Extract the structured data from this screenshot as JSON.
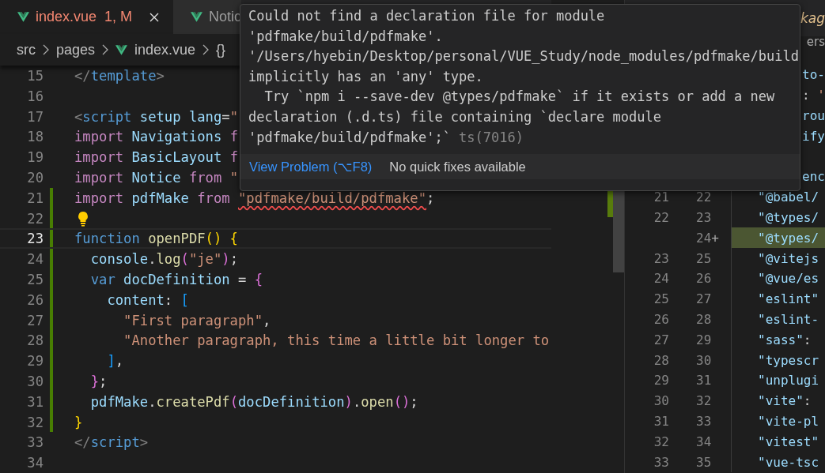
{
  "editor": {
    "tabs": [
      {
        "label": "index.vue",
        "badge": "1, M",
        "selected": true,
        "error": true
      },
      {
        "label": "Notic",
        "selected": false
      }
    ],
    "breadcrumb": [
      "src",
      "pages",
      "index.vue",
      "{}"
    ],
    "lines": [
      {
        "number": "15",
        "modified": false,
        "current": false,
        "tokens": [
          {
            "kind": "tag",
            "text": "</"
          },
          {
            "kind": "tagname",
            "text": "template"
          },
          {
            "kind": "tag",
            "text": ">"
          }
        ]
      },
      {
        "number": "16",
        "modified": false,
        "current": false
      },
      {
        "number": "17",
        "modified": false,
        "current": false,
        "tokens": [
          {
            "kind": "tag",
            "text": "<"
          },
          {
            "kind": "tagname",
            "text": "script "
          },
          {
            "kind": "attr",
            "text": "setup lang"
          },
          {
            "kind": "punct",
            "text": "="
          },
          {
            "kind": "string",
            "text": "\""
          }
        ]
      },
      {
        "number": "18",
        "modified": false,
        "current": false,
        "tokens": [
          {
            "kind": "keyword",
            "text": "import "
          },
          {
            "kind": "var",
            "text": "Navigations "
          },
          {
            "kind": "keyword",
            "text": "f"
          }
        ]
      },
      {
        "number": "19",
        "modified": false,
        "current": false,
        "tokens": [
          {
            "kind": "keyword",
            "text": "import "
          },
          {
            "kind": "var",
            "text": "BasicLayout "
          },
          {
            "kind": "keyword",
            "text": "f"
          }
        ]
      },
      {
        "number": "20",
        "modified": false,
        "current": false,
        "tokens": [
          {
            "kind": "keyword",
            "text": "import "
          },
          {
            "kind": "var",
            "text": "Notice "
          },
          {
            "kind": "keyword",
            "text": "from "
          },
          {
            "kind": "string",
            "text": "\""
          }
        ]
      },
      {
        "number": "21",
        "modified": true,
        "current": false,
        "tokens": [
          {
            "kind": "keyword",
            "text": "import "
          },
          {
            "kind": "var",
            "text": "pdfMake "
          },
          {
            "kind": "keyword",
            "text": "from "
          },
          {
            "kind": "string",
            "text": "\"pdfmake/build/pdfmake\"",
            "squiggle": true
          },
          {
            "kind": "punct",
            "text": ";"
          }
        ]
      },
      {
        "number": "22",
        "modified": true,
        "current": false,
        "lightbulb": true
      },
      {
        "number": "23",
        "modified": true,
        "current": true,
        "tokens": [
          {
            "kind": "storage",
            "text": "function "
          },
          {
            "kind": "fn",
            "text": "openPDF"
          },
          {
            "kind": "brace1",
            "text": "() {"
          }
        ]
      },
      {
        "number": "24",
        "modified": true,
        "current": false,
        "tokens": [
          {
            "kind": "var",
            "text": "  console"
          },
          {
            "kind": "punct",
            "text": "."
          },
          {
            "kind": "fn",
            "text": "log"
          },
          {
            "kind": "brace2",
            "text": "("
          },
          {
            "kind": "string",
            "text": "\"je\""
          },
          {
            "kind": "brace2",
            "text": ")"
          },
          {
            "kind": "punct",
            "text": ";"
          }
        ]
      },
      {
        "number": "25",
        "modified": true,
        "current": false,
        "tokens": [
          {
            "kind": "storage",
            "text": "  var "
          },
          {
            "kind": "var",
            "text": "docDefinition"
          },
          {
            "kind": "punct",
            "text": " = "
          },
          {
            "kind": "brace2",
            "text": "{"
          }
        ]
      },
      {
        "number": "26",
        "modified": true,
        "current": false,
        "tokens": [
          {
            "kind": "var",
            "text": "    content"
          },
          {
            "kind": "punct",
            "text": ": "
          },
          {
            "kind": "brace3",
            "text": "["
          }
        ]
      },
      {
        "number": "27",
        "modified": true,
        "current": false,
        "tokens": [
          {
            "kind": "string",
            "text": "      \"First paragraph\""
          },
          {
            "kind": "punct",
            "text": ","
          }
        ]
      },
      {
        "number": "28",
        "modified": true,
        "current": false,
        "tokens": [
          {
            "kind": "string",
            "text": "      \"Another paragraph, this time a little bit longer to"
          }
        ]
      },
      {
        "number": "29",
        "modified": true,
        "current": false,
        "tokens": [
          {
            "kind": "brace3",
            "text": "    ]"
          },
          {
            "kind": "punct",
            "text": ","
          }
        ]
      },
      {
        "number": "30",
        "modified": true,
        "current": false,
        "tokens": [
          {
            "kind": "brace2",
            "text": "  }"
          },
          {
            "kind": "punct",
            "text": ";"
          }
        ]
      },
      {
        "number": "31",
        "modified": true,
        "current": false,
        "tokens": [
          {
            "kind": "var",
            "text": "  pdfMake"
          },
          {
            "kind": "punct",
            "text": "."
          },
          {
            "kind": "fn",
            "text": "createPdf"
          },
          {
            "kind": "brace2",
            "text": "("
          },
          {
            "kind": "var",
            "text": "docDefinition"
          },
          {
            "kind": "brace2",
            "text": ")"
          },
          {
            "kind": "punct",
            "text": "."
          },
          {
            "kind": "fn",
            "text": "open"
          },
          {
            "kind": "brace2",
            "text": "()"
          },
          {
            "kind": "punct",
            "text": ";"
          }
        ]
      },
      {
        "number": "32",
        "modified": true,
        "current": false,
        "tokens": [
          {
            "kind": "brace1",
            "text": "}"
          }
        ]
      },
      {
        "number": "33",
        "modified": false,
        "current": false,
        "tokens": [
          {
            "kind": "tag",
            "text": "</"
          },
          {
            "kind": "tagname",
            "text": "script"
          },
          {
            "kind": "tag",
            "text": ">"
          }
        ]
      },
      {
        "number": "34",
        "modified": false,
        "current": false
      }
    ]
  },
  "diff": {
    "tab": "kag",
    "breadcrumb": "ers",
    "rows": [
      {
        "kind": "fragment",
        "tokens": [
          {
            "kind": "var",
            "text": "to-"
          }
        ]
      },
      {
        "kind": "fragment",
        "tokens": [
          {
            "kind": "punct",
            "text": ": "
          },
          {
            "kind": "string",
            "text": "'"
          }
        ]
      },
      {
        "kind": "fragment",
        "tokens": [
          {
            "kind": "var",
            "text": "rou"
          }
        ]
      },
      {
        "kind": "fragment",
        "tokens": [
          {
            "kind": "var",
            "text": "ify"
          }
        ]
      },
      {
        "kind": "blank"
      },
      {
        "kind": "fragment",
        "tokens": [
          {
            "kind": "var",
            "text": "enc"
          }
        ]
      },
      {
        "kind": "line",
        "old": "21",
        "new": "22",
        "added": false,
        "tokens": [
          {
            "kind": "var",
            "text": "\"@babel/"
          }
        ]
      },
      {
        "kind": "line",
        "old": "22",
        "new": "23",
        "added": false,
        "tokens": [
          {
            "kind": "var",
            "text": "\"@types/"
          }
        ]
      },
      {
        "kind": "line",
        "new": "24",
        "marker": "+",
        "added": true,
        "tokens": [
          {
            "kind": "var",
            "text": "\"@types/"
          }
        ]
      },
      {
        "kind": "line",
        "old": "23",
        "new": "25",
        "added": false,
        "tokens": [
          {
            "kind": "var",
            "text": "\"@vitejs"
          }
        ]
      },
      {
        "kind": "line",
        "old": "24",
        "new": "26",
        "added": false,
        "tokens": [
          {
            "kind": "var",
            "text": "\"@vue/es"
          }
        ]
      },
      {
        "kind": "line",
        "old": "25",
        "new": "27",
        "added": false,
        "tokens": [
          {
            "kind": "var",
            "text": "\"eslint\""
          }
        ]
      },
      {
        "kind": "line",
        "old": "26",
        "new": "28",
        "added": false,
        "tokens": [
          {
            "kind": "var",
            "text": "\"eslint-"
          }
        ]
      },
      {
        "kind": "line",
        "old": "27",
        "new": "29",
        "added": false,
        "tokens": [
          {
            "kind": "var",
            "text": "\"sass\""
          },
          {
            "kind": "punct",
            "text": ":"
          }
        ]
      },
      {
        "kind": "line",
        "old": "28",
        "new": "30",
        "added": false,
        "tokens": [
          {
            "kind": "var",
            "text": "\"typescr"
          }
        ]
      },
      {
        "kind": "line",
        "old": "29",
        "new": "31",
        "added": false,
        "tokens": [
          {
            "kind": "var",
            "text": "\"unplugi"
          }
        ]
      },
      {
        "kind": "line",
        "old": "30",
        "new": "32",
        "added": false,
        "tokens": [
          {
            "kind": "var",
            "text": "\"vite\""
          },
          {
            "kind": "punct",
            "text": ":"
          }
        ]
      },
      {
        "kind": "line",
        "old": "31",
        "new": "33",
        "added": false,
        "tokens": [
          {
            "kind": "var",
            "text": "\"vite-pl"
          }
        ]
      },
      {
        "kind": "line",
        "old": "32",
        "new": "34",
        "added": false,
        "tokens": [
          {
            "kind": "var",
            "text": "\"vitest\""
          }
        ]
      },
      {
        "kind": "line",
        "old": "33",
        "new": "35",
        "added": false,
        "tokens": [
          {
            "kind": "var",
            "text": "\"vue-tsc"
          }
        ]
      }
    ]
  },
  "hover": {
    "message": "Could not find a declaration file for module\n'pdfmake/build/pdfmake'.\n'/Users/hyebin/Desktop/personal/VUE_Study/node_modules/pdfmake/build\nimplicitly has an 'any' type.\n  Try `npm i --save-dev @types/pdfmake` if it exists or add a new\ndeclaration (.d.ts) file containing `declare module\n'pdfmake/build/pdfmake';` ",
    "code": "ts(7016)",
    "link": "View Problem (⌥F8)",
    "note": "No quick fixes available"
  }
}
